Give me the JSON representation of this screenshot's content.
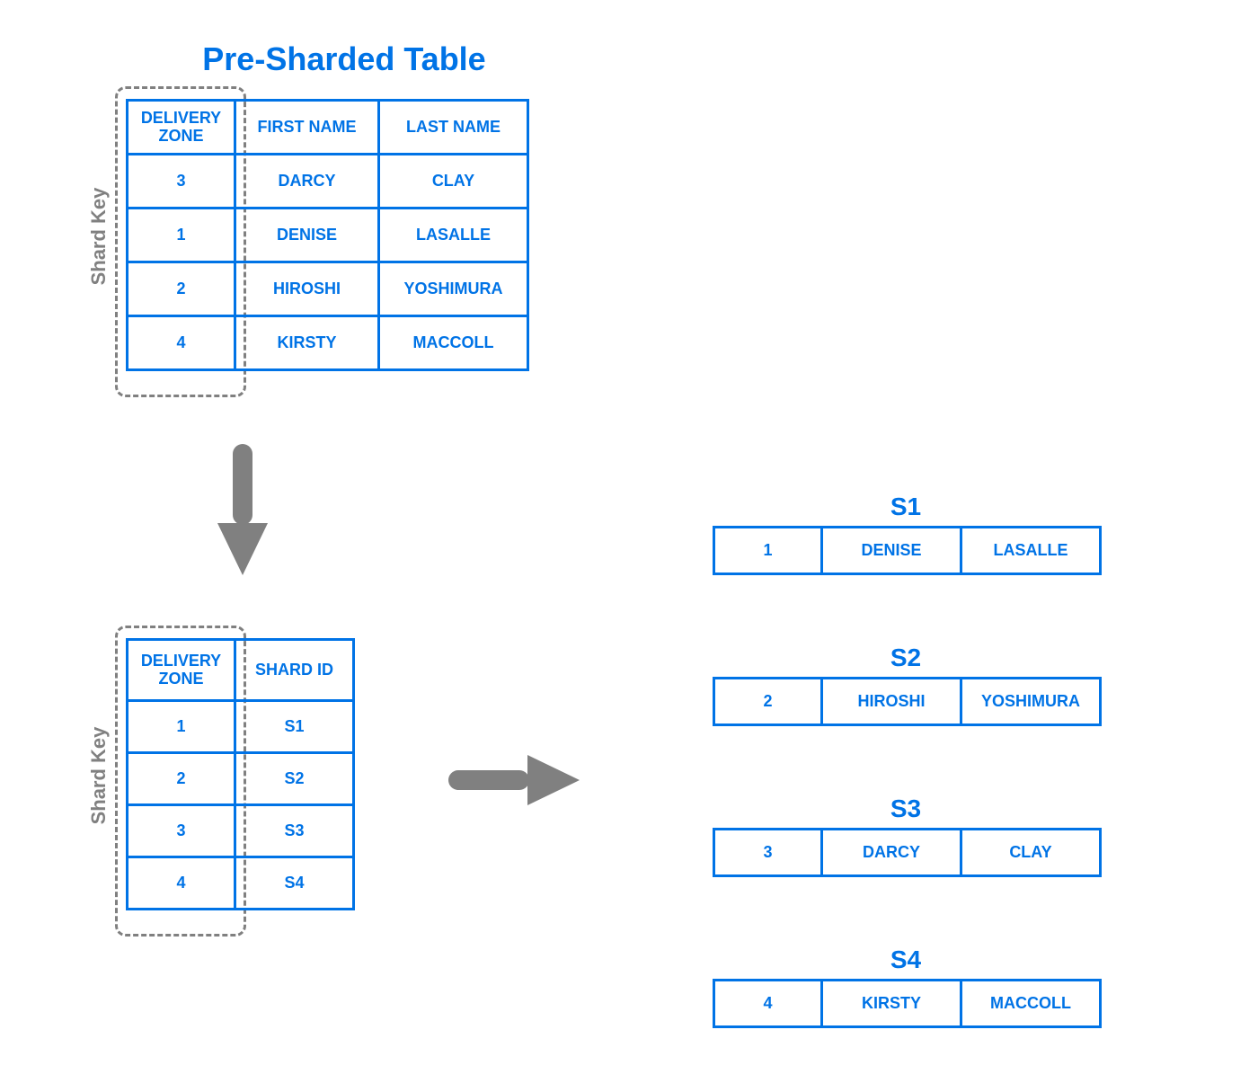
{
  "colors": {
    "accent": "#0073e6",
    "gray": "#808080"
  },
  "title": "Pre-Sharded Table",
  "shard_key_label": "Shard Key",
  "pre_sharded_table": {
    "headers": [
      "DELIVERY ZONE",
      "FIRST NAME",
      "LAST NAME"
    ],
    "rows": [
      {
        "zone": "3",
        "first": "DARCY",
        "last": "CLAY"
      },
      {
        "zone": "1",
        "first": "DENISE",
        "last": "LASALLE"
      },
      {
        "zone": "2",
        "first": "HIROSHI",
        "last": "YOSHIMURA"
      },
      {
        "zone": "4",
        "first": "KIRSTY",
        "last": "MACCOLL"
      }
    ]
  },
  "lookup_table": {
    "headers": [
      "DELIVERY ZONE",
      "SHARD ID"
    ],
    "rows": [
      {
        "zone": "1",
        "shard": "S1"
      },
      {
        "zone": "2",
        "shard": "S2"
      },
      {
        "zone": "3",
        "shard": "S3"
      },
      {
        "zone": "4",
        "shard": "S4"
      }
    ]
  },
  "shards": [
    {
      "name": "S1",
      "row": {
        "zone": "1",
        "first": "DENISE",
        "last": "LASALLE"
      }
    },
    {
      "name": "S2",
      "row": {
        "zone": "2",
        "first": "HIROSHI",
        "last": "YOSHIMURA"
      }
    },
    {
      "name": "S3",
      "row": {
        "zone": "3",
        "first": "DARCY",
        "last": "CLAY"
      }
    },
    {
      "name": "S4",
      "row": {
        "zone": "4",
        "first": "KIRSTY",
        "last": "MACCOLL"
      }
    }
  ]
}
